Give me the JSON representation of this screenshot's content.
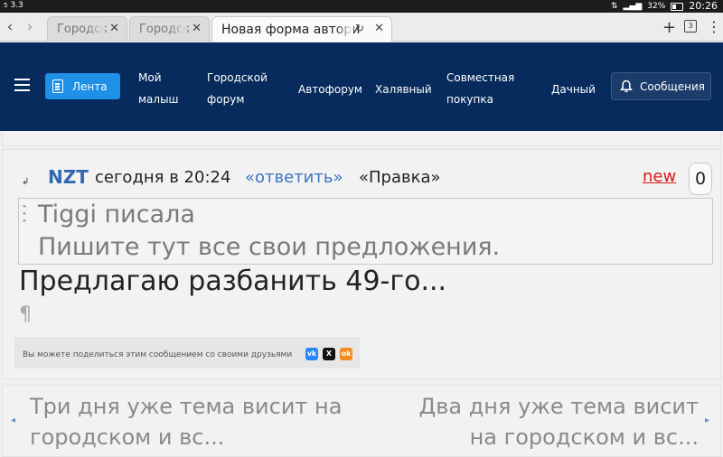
{
  "status_bar": {
    "left_text": "3.3",
    "left_badge": "5",
    "battery": "32%",
    "time": "20:26"
  },
  "browser": {
    "tabs": [
      {
        "label": "Городск"
      },
      {
        "label": "Городск"
      },
      {
        "label": "Новая форма автори"
      }
    ],
    "tab_count": "3"
  },
  "site_nav": {
    "lenta": "Лента",
    "links": [
      {
        "line1": "Мой",
        "line2": "малыш"
      },
      {
        "line1": "Городской",
        "line2": "форум"
      },
      {
        "line1": "Автофорум",
        "line2": ""
      },
      {
        "line1": "Халявный",
        "line2": ""
      },
      {
        "line1": "Совместная",
        "line2": "покупка"
      },
      {
        "line1": "Дачный",
        "line2": ""
      }
    ],
    "messages": "Сообщения"
  },
  "post": {
    "author": "NZT",
    "time": "сегодня в 20:24",
    "reply": "«ответить»",
    "edit": "«Правка»",
    "new_label": "new",
    "counter": "0",
    "quote_author": "Tiggi писала",
    "quote_text": "Пишите тут все свои предложения.",
    "body": "Предлагаю разбанить 49-го...",
    "pilcrow": "¶",
    "share_text": "Вы можете поделиться этим сообщением со своими друзьями"
  },
  "pager": {
    "prev": "Три дня уже тема висит на городском и вс...",
    "next": "Два дня уже тема висит на городском и вс..."
  },
  "colors": {
    "nav_bg": "#062b5c",
    "accent": "#1e90e6",
    "author": "#3168b0",
    "new": "#d71a1a"
  }
}
